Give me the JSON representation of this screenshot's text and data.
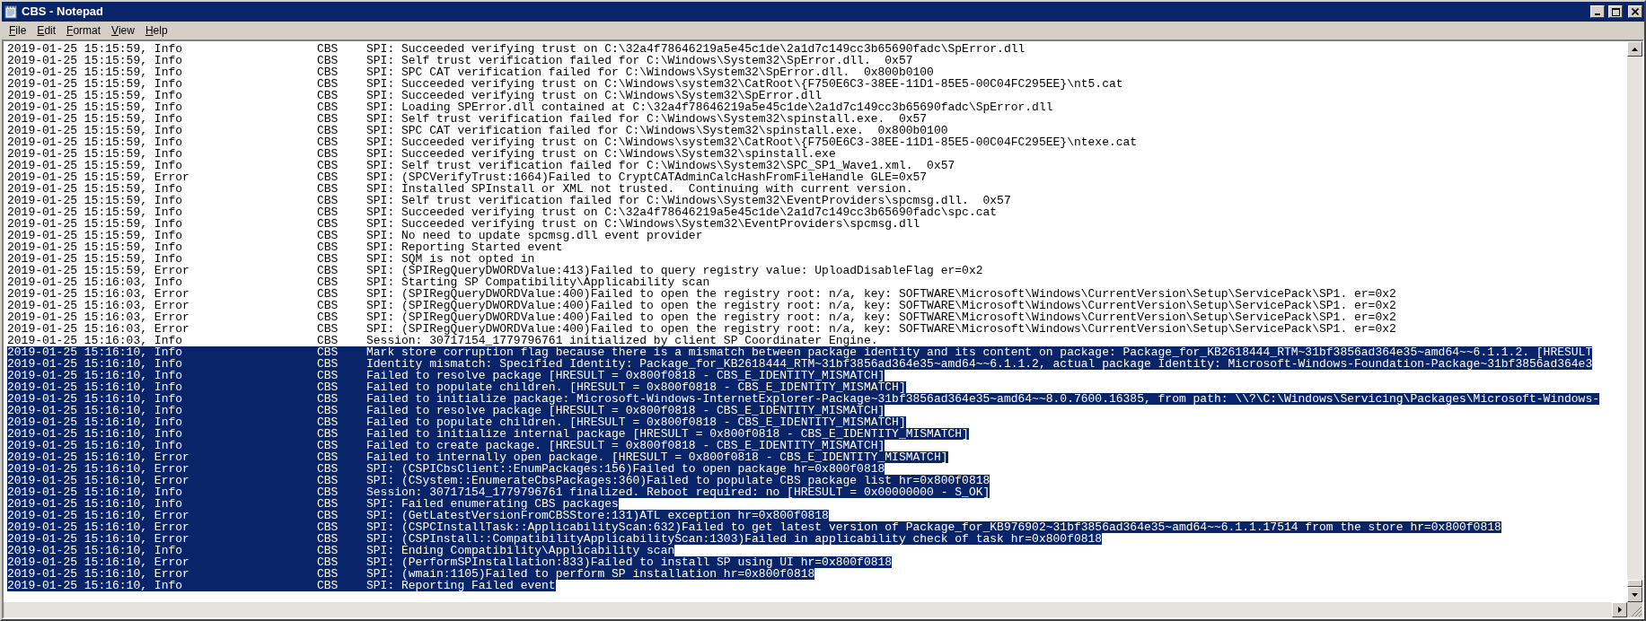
{
  "window": {
    "title": "CBS - Notepad"
  },
  "menu": [
    "File",
    "Edit",
    "Format",
    "View",
    "Help"
  ],
  "lines": [
    {
      "stamp": "2019-01-25 15:15:59, Info",
      "source": "CBS",
      "message": "SPI: Succeeded verifying trust on C:\\32a4f78646219a5e45c1de\\2a1d7c149cc3b65690fadc\\SpError.dll",
      "selected": false
    },
    {
      "stamp": "2019-01-25 15:15:59, Info",
      "source": "CBS",
      "message": "SPI: Self trust verification failed for C:\\Windows\\System32\\SpError.dll.  0x57",
      "selected": false
    },
    {
      "stamp": "2019-01-25 15:15:59, Info",
      "source": "CBS",
      "message": "SPI: SPC CAT verification failed for C:\\Windows\\System32\\SpError.dll.  0x800b0100",
      "selected": false
    },
    {
      "stamp": "2019-01-25 15:15:59, Info",
      "source": "CBS",
      "message": "SPI: Succeeded verifying trust on C:\\Windows\\system32\\CatRoot\\{F750E6C3-38EE-11D1-85E5-00C04FC295EE}\\nt5.cat",
      "selected": false
    },
    {
      "stamp": "2019-01-25 15:15:59, Info",
      "source": "CBS",
      "message": "SPI: Succeeded verifying trust on C:\\Windows\\System32\\SpError.dll",
      "selected": false
    },
    {
      "stamp": "2019-01-25 15:15:59, Info",
      "source": "CBS",
      "message": "SPI: Loading SPError.dll contained at C:\\32a4f78646219a5e45c1de\\2a1d7c149cc3b65690fadc\\SpError.dll",
      "selected": false
    },
    {
      "stamp": "2019-01-25 15:15:59, Info",
      "source": "CBS",
      "message": "SPI: Self trust verification failed for C:\\Windows\\System32\\spinstall.exe.  0x57",
      "selected": false
    },
    {
      "stamp": "2019-01-25 15:15:59, Info",
      "source": "CBS",
      "message": "SPI: SPC CAT verification failed for C:\\Windows\\System32\\spinstall.exe.  0x800b0100",
      "selected": false
    },
    {
      "stamp": "2019-01-25 15:15:59, Info",
      "source": "CBS",
      "message": "SPI: Succeeded verifying trust on C:\\Windows\\system32\\CatRoot\\{F750E6C3-38EE-11D1-85E5-00C04FC295EE}\\ntexe.cat",
      "selected": false
    },
    {
      "stamp": "2019-01-25 15:15:59, Info",
      "source": "CBS",
      "message": "SPI: Succeeded verifying trust on C:\\Windows\\System32\\spinstall.exe",
      "selected": false
    },
    {
      "stamp": "2019-01-25 15:15:59, Info",
      "source": "CBS",
      "message": "SPI: Self trust verification failed for C:\\Windows\\System32\\SPC_SP1_Wave1.xml.  0x57",
      "selected": false
    },
    {
      "stamp": "2019-01-25 15:15:59, Error",
      "source": "CBS",
      "message": "SPI: (SPCVerifyTrust:1664)Failed to CryptCATAdminCalcHashFromFileHandle GLE=0x57",
      "selected": false
    },
    {
      "stamp": "2019-01-25 15:15:59, Info",
      "source": "CBS",
      "message": "SPI: Installed SPInstall or XML not trusted.  Continuing with current version.",
      "selected": false
    },
    {
      "stamp": "2019-01-25 15:15:59, Info",
      "source": "CBS",
      "message": "SPI: Self trust verification failed for C:\\Windows\\System32\\EventProviders\\spcmsg.dll.  0x57",
      "selected": false
    },
    {
      "stamp": "2019-01-25 15:15:59, Info",
      "source": "CBS",
      "message": "SPI: Succeeded verifying trust on C:\\32a4f78646219a5e45c1de\\2a1d7c149cc3b65690fadc\\spc.cat",
      "selected": false
    },
    {
      "stamp": "2019-01-25 15:15:59, Info",
      "source": "CBS",
      "message": "SPI: Succeeded verifying trust on C:\\Windows\\System32\\EventProviders\\spcmsg.dll",
      "selected": false
    },
    {
      "stamp": "2019-01-25 15:15:59, Info",
      "source": "CBS",
      "message": "SPI: No need to update spcmsg.dll event provider",
      "selected": false
    },
    {
      "stamp": "2019-01-25 15:15:59, Info",
      "source": "CBS",
      "message": "SPI: Reporting Started event",
      "selected": false
    },
    {
      "stamp": "2019-01-25 15:15:59, Info",
      "source": "CBS",
      "message": "SPI: SQM is not opted in",
      "selected": false
    },
    {
      "stamp": "2019-01-25 15:15:59, Error",
      "source": "CBS",
      "message": "SPI: (SPIRegQueryDWORDValue:413)Failed to query registry value: UploadDisableFlag er=0x2",
      "selected": false
    },
    {
      "stamp": "2019-01-25 15:16:03, Info",
      "source": "CBS",
      "message": "SPI: Starting SP Compatibility\\Applicability scan",
      "selected": false
    },
    {
      "stamp": "2019-01-25 15:16:03, Error",
      "source": "CBS",
      "message": "SPI: (SPIRegQueryDWORDValue:400)Failed to open the registry root: n/a, key: SOFTWARE\\Microsoft\\Windows\\CurrentVersion\\Setup\\ServicePack\\SP1. er=0x2",
      "selected": false
    },
    {
      "stamp": "2019-01-25 15:16:03, Error",
      "source": "CBS",
      "message": "SPI: (SPIRegQueryDWORDValue:400)Failed to open the registry root: n/a, key: SOFTWARE\\Microsoft\\Windows\\CurrentVersion\\Setup\\ServicePack\\SP1. er=0x2",
      "selected": false
    },
    {
      "stamp": "2019-01-25 15:16:03, Error",
      "source": "CBS",
      "message": "SPI: (SPIRegQueryDWORDValue:400)Failed to open the registry root: n/a, key: SOFTWARE\\Microsoft\\Windows\\CurrentVersion\\Setup\\ServicePack\\SP1. er=0x2",
      "selected": false
    },
    {
      "stamp": "2019-01-25 15:16:03, Error",
      "source": "CBS",
      "message": "SPI: (SPIRegQueryDWORDValue:400)Failed to open the registry root: n/a, key: SOFTWARE\\Microsoft\\Windows\\CurrentVersion\\Setup\\ServicePack\\SP1. er=0x2",
      "selected": false
    },
    {
      "stamp": "2019-01-25 15:16:03, Info",
      "source": "CBS",
      "message": "Session: 30717154_1779796761 initialized by client SP Coordinater Engine.",
      "selected": false
    },
    {
      "stamp": "2019-01-25 15:16:10, Info",
      "source": "CBS",
      "message": "Mark store corruption flag because there is a mismatch between package identity and its content on package: Package_for_KB2618444_RTM~31bf3856ad364e35~amd64~~6.1.1.2. [HRESULT",
      "selected": true
    },
    {
      "stamp": "2019-01-25 15:16:10, Info",
      "source": "CBS",
      "message": "Identity mismatch: Specified Identity: Package_for_KB2618444_RTM~31bf3856ad364e35~amd64~~6.1.1.2, actual package Identity: Microsoft-Windows-Foundation-Package~31bf3856ad364e3",
      "selected": true
    },
    {
      "stamp": "2019-01-25 15:16:10, Info",
      "source": "CBS",
      "message": "Failed to resolve package [HRESULT = 0x800f0818 - CBS_E_IDENTITY_MISMATCH]",
      "selected": true
    },
    {
      "stamp": "2019-01-25 15:16:10, Info",
      "source": "CBS",
      "message": "Failed to populate children. [HRESULT = 0x800f0818 - CBS_E_IDENTITY_MISMATCH]",
      "selected": true
    },
    {
      "stamp": "2019-01-25 15:16:10, Info",
      "source": "CBS",
      "message": "Failed to initialize package: Microsoft-Windows-InternetExplorer-Package~31bf3856ad364e35~amd64~~8.0.7600.16385, from path: \\\\?\\C:\\Windows\\Servicing\\Packages\\Microsoft-Windows-",
      "selected": true
    },
    {
      "stamp": "2019-01-25 15:16:10, Info",
      "source": "CBS",
      "message": "Failed to resolve package [HRESULT = 0x800f0818 - CBS_E_IDENTITY_MISMATCH]",
      "selected": true
    },
    {
      "stamp": "2019-01-25 15:16:10, Info",
      "source": "CBS",
      "message": "Failed to populate children. [HRESULT = 0x800f0818 - CBS_E_IDENTITY_MISMATCH]",
      "selected": true
    },
    {
      "stamp": "2019-01-25 15:16:10, Info",
      "source": "CBS",
      "message": "Failed to initialize internal package [HRESULT = 0x800f0818 - CBS_E_IDENTITY_MISMATCH]",
      "selected": true
    },
    {
      "stamp": "2019-01-25 15:16:10, Info",
      "source": "CBS",
      "message": "Failed to create package. [HRESULT = 0x800f0818 - CBS_E_IDENTITY_MISMATCH]",
      "selected": true
    },
    {
      "stamp": "2019-01-25 15:16:10, Error",
      "source": "CBS",
      "message": "Failed to internally open package. [HRESULT = 0x800f0818 - CBS_E_IDENTITY_MISMATCH]",
      "selected": true
    },
    {
      "stamp": "2019-01-25 15:16:10, Error",
      "source": "CBS",
      "message": "SPI: (CSPICbsClient::EnumPackages:156)Failed to open package hr=0x800f0818",
      "selected": true
    },
    {
      "stamp": "2019-01-25 15:16:10, Error",
      "source": "CBS",
      "message": "SPI: (CSystem::EnumerateCbsPackages:360)Failed to populate CBS package list hr=0x800f0818",
      "selected": true
    },
    {
      "stamp": "2019-01-25 15:16:10, Info",
      "source": "CBS",
      "message": "Session: 30717154_1779796761 finalized. Reboot required: no [HRESULT = 0x00000000 - S_OK]",
      "selected": true
    },
    {
      "stamp": "2019-01-25 15:16:10, Info",
      "source": "CBS",
      "message": "SPI: Failed enumerating CBS packages",
      "selected": true
    },
    {
      "stamp": "2019-01-25 15:16:10, Error",
      "source": "CBS",
      "message": "SPI: (GetLatestVersionFromCBSStore:131)ATL exception hr=0x800f0818",
      "selected": true
    },
    {
      "stamp": "2019-01-25 15:16:10, Error",
      "source": "CBS",
      "message": "SPI: (CSPCInstallTask::ApplicabilityScan:632)Failed to get latest version of Package_for_KB976902~31bf3856ad364e35~amd64~~6.1.1.17514 from the store hr=0x800f0818",
      "selected": true
    },
    {
      "stamp": "2019-01-25 15:16:10, Error",
      "source": "CBS",
      "message": "SPI: (CSPInstall::CompatibilityApplicabilityScan:1303)Failed in applicability check of task hr=0x800f0818",
      "selected": true
    },
    {
      "stamp": "2019-01-25 15:16:10, Info",
      "source": "CBS",
      "message": "SPI: Ending Compatibility\\Applicability scan",
      "selected": true
    },
    {
      "stamp": "2019-01-25 15:16:10, Error",
      "source": "CBS",
      "message": "SPI: (PerformSPInstallation:833)Failed to install SP using UI hr=0x800f0818",
      "selected": true
    },
    {
      "stamp": "2019-01-25 15:16:10, Error",
      "source": "CBS",
      "message": "SPI: (wmain:1105)Failed to perform SP installation hr=0x800f0818",
      "selected": true
    },
    {
      "stamp": "2019-01-25 15:16:10, Info",
      "source": "CBS",
      "message": "SPI: Reporting Failed event",
      "selected": true
    }
  ]
}
